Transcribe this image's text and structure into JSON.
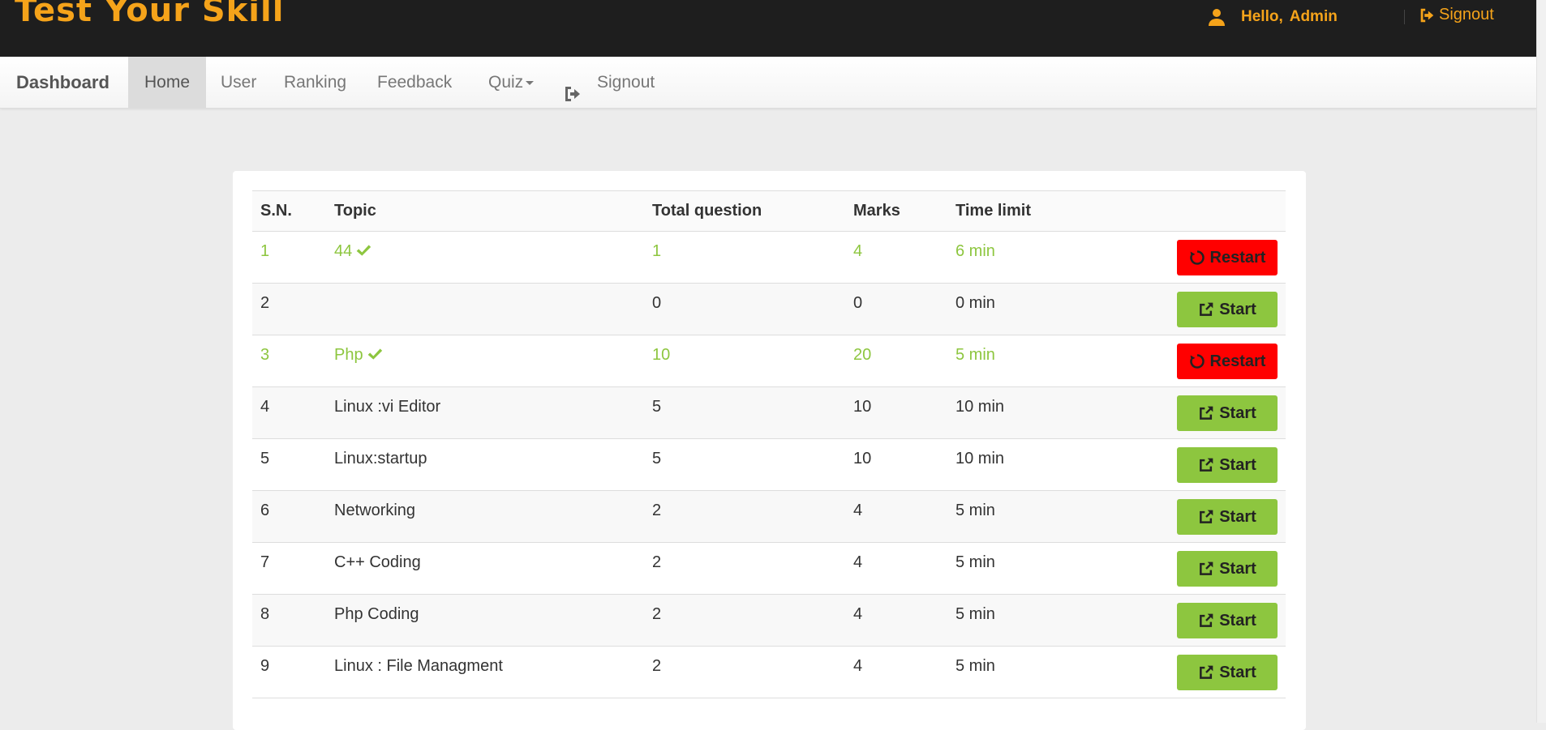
{
  "header": {
    "brand": "Test Your Skill",
    "greeting": "Hello,",
    "user": "Admin",
    "signout_label": "Signout",
    "accent_color": "#f5a31a"
  },
  "nav": {
    "dashboard": "Dashboard",
    "home": "Home",
    "user": "User",
    "ranking": "Ranking",
    "feedback": "Feedback",
    "quiz": "Quiz",
    "signout": "Signout"
  },
  "table": {
    "headers": {
      "sn": "S.N.",
      "topic": "Topic",
      "total": "Total question",
      "marks": "Marks",
      "time": "Time limit"
    },
    "rows": [
      {
        "sn": "1",
        "topic": "44",
        "total": "1",
        "marks": "4",
        "time": "6 min",
        "action": "Restart",
        "done": true
      },
      {
        "sn": "2",
        "topic": "",
        "total": "0",
        "marks": "0",
        "time": "0 min",
        "action": "Start",
        "done": false
      },
      {
        "sn": "3",
        "topic": "Php",
        "total": "10",
        "marks": "20",
        "time": "5 min",
        "action": "Restart",
        "done": true
      },
      {
        "sn": "4",
        "topic": "Linux :vi Editor",
        "total": "5",
        "marks": "10",
        "time": "10 min",
        "action": "Start",
        "done": false
      },
      {
        "sn": "5",
        "topic": "Linux:startup",
        "total": "5",
        "marks": "10",
        "time": "10 min",
        "action": "Start",
        "done": false
      },
      {
        "sn": "6",
        "topic": "Networking",
        "total": "2",
        "marks": "4",
        "time": "5 min",
        "action": "Start",
        "done": false
      },
      {
        "sn": "7",
        "topic": "C++ Coding",
        "total": "2",
        "marks": "4",
        "time": "5 min",
        "action": "Start",
        "done": false
      },
      {
        "sn": "8",
        "topic": "Php Coding",
        "total": "2",
        "marks": "4",
        "time": "5 min",
        "action": "Start",
        "done": false
      },
      {
        "sn": "9",
        "topic": "Linux : File Managment",
        "total": "2",
        "marks": "4",
        "time": "5 min",
        "action": "Start",
        "done": false
      }
    ]
  },
  "colors": {
    "done_text": "#8dc63f",
    "start_button": "#8dc63f",
    "restart_button": "#ff0000"
  },
  "icons": {
    "user": "user-icon",
    "signout": "sign-out-icon",
    "check": "check-icon",
    "restart": "refresh-icon",
    "start": "external-link-icon"
  }
}
